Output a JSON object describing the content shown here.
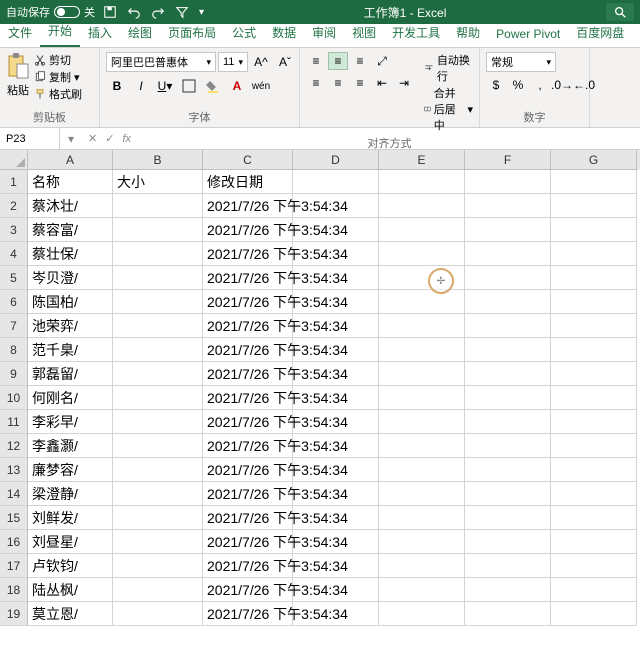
{
  "titlebar": {
    "autosave_label": "自动保存",
    "autosave_state": "关",
    "title": "工作簿1 - Excel"
  },
  "tabs": [
    "文件",
    "开始",
    "插入",
    "绘图",
    "页面布局",
    "公式",
    "数据",
    "审阅",
    "视图",
    "开发工具",
    "帮助",
    "Power Pivot",
    "百度网盘"
  ],
  "active_tab": 1,
  "ribbon": {
    "clipboard": {
      "paste": "粘贴",
      "cut": "剪切",
      "copy": "复制",
      "format": "格式刷",
      "label": "剪贴板"
    },
    "font": {
      "name": "阿里巴巴普惠体",
      "size": "11",
      "label": "字体"
    },
    "align": {
      "wrap": "自动换行",
      "merge": "合并后居中",
      "label": "对齐方式"
    },
    "number": {
      "format": "常规",
      "label": "数字"
    }
  },
  "namebox": "P23",
  "columns": [
    "A",
    "B",
    "C",
    "D",
    "E",
    "F",
    "G"
  ],
  "header_row": {
    "A": "名称",
    "B": "大小",
    "C": "修改日期"
  },
  "rows": [
    {
      "n": 2,
      "A": "蔡沐壮/",
      "C": "2021/7/26 下午3:54:34"
    },
    {
      "n": 3,
      "A": "蔡容富/",
      "C": "2021/7/26 下午3:54:34"
    },
    {
      "n": 4,
      "A": "蔡壮保/",
      "C": "2021/7/26 下午3:54:34"
    },
    {
      "n": 5,
      "A": "岑贝澄/",
      "C": "2021/7/26 下午3:54:34"
    },
    {
      "n": 6,
      "A": "陈国柏/",
      "C": "2021/7/26 下午3:54:34"
    },
    {
      "n": 7,
      "A": "池荣弈/",
      "C": "2021/7/26 下午3:54:34"
    },
    {
      "n": 8,
      "A": "范千臬/",
      "C": "2021/7/26 下午3:54:34"
    },
    {
      "n": 9,
      "A": "郭磊留/",
      "C": "2021/7/26 下午3:54:34"
    },
    {
      "n": 10,
      "A": "何刚名/",
      "C": "2021/7/26 下午3:54:34"
    },
    {
      "n": 11,
      "A": "李彩早/",
      "C": "2021/7/26 下午3:54:34"
    },
    {
      "n": 12,
      "A": "李鑫灏/",
      "C": "2021/7/26 下午3:54:34"
    },
    {
      "n": 13,
      "A": "廉梦容/",
      "C": "2021/7/26 下午3:54:34"
    },
    {
      "n": 14,
      "A": "梁澄静/",
      "C": "2021/7/26 下午3:54:34"
    },
    {
      "n": 15,
      "A": "刘鲜发/",
      "C": "2021/7/26 下午3:54:34"
    },
    {
      "n": 16,
      "A": "刘昼星/",
      "C": "2021/7/26 下午3:54:34"
    },
    {
      "n": 17,
      "A": "卢钦钧/",
      "C": "2021/7/26 下午3:54:34"
    },
    {
      "n": 18,
      "A": "陆丛枫/",
      "C": "2021/7/26 下午3:54:34"
    },
    {
      "n": 19,
      "A": "莫立恩/",
      "C": "2021/7/26 下午3:54:34"
    }
  ]
}
